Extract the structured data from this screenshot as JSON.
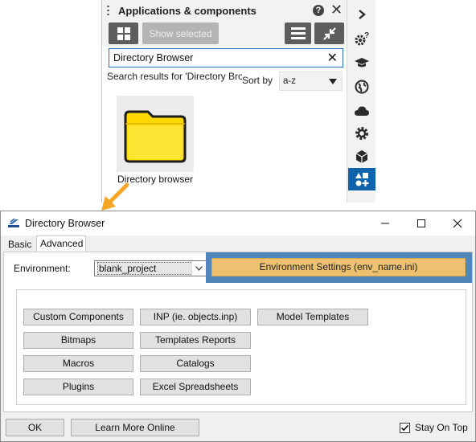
{
  "apps_panel": {
    "title": "Applications & components",
    "help_glyph": "?",
    "show_selected_label": "Show selected",
    "search": {
      "value": "Directory Browser",
      "placeholder": ""
    },
    "search_results_text": "Search results for 'Directory Browser'",
    "sort_by_label": "Sort by",
    "sort_value": "a-z",
    "result": {
      "label": "Directory browser",
      "icon": "folder-icon",
      "folder_color": "#ffd800"
    },
    "sidebar_icons": [
      "chevron-right-icon",
      "gear-question-icon",
      "graduation-cap-icon",
      "globe-icon",
      "cloud-icon",
      "gear-icon",
      "cube-icon",
      "apps-add-icon"
    ],
    "active_sidebar_icon": "apps-add-icon",
    "accent_color": "#0f63a8"
  },
  "annotation_arrow_color": "#f5a623",
  "dir_window": {
    "title": "Directory Browser",
    "tabs": [
      "Basic",
      "Advanced"
    ],
    "active_tab": "Advanced",
    "environment_label": "Environment:",
    "environment_value": "blank_project",
    "env_settings_label": "Environment Settings (env_name.ini)",
    "env_settings_color": "#eec170",
    "highlight_color": "#4f87b9",
    "buttons": {
      "custom_components": "Custom Components",
      "inp": "INP (ie. objects.inp)",
      "model_templates": "Model Templates",
      "bitmaps": "Bitmaps",
      "templates_reports": "Templates Reports",
      "macros": "Macros",
      "catalogs": "Catalogs",
      "plugins": "Plugins",
      "excel_spreadsheets": "Excel Spreadsheets"
    },
    "ok_label": "OK",
    "learn_more_label": "Learn More Online",
    "stay_on_top_label": "Stay On Top",
    "stay_on_top_checked": true
  }
}
